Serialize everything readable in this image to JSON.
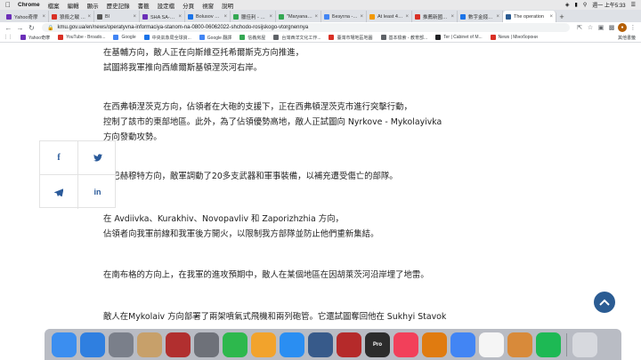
{
  "menubar": {
    "app": "Chrome",
    "items": [
      "檔案",
      "編輯",
      "顯示",
      "歷史記錄",
      "書籤",
      "設定檔",
      "分頁",
      "視窗",
      "說明"
    ],
    "clock": "週一 上午5:33",
    "apple_icon": "apple-icon"
  },
  "tabs": [
    {
      "label": "Yahoo奇摩",
      "color": "#6b2fb8"
    },
    {
      "label": "狼殺之戰 2：世",
      "color": "#d93025"
    },
    {
      "label": "Bl",
      "color": "#555555"
    },
    {
      "label": "SHA SA-伊莎卡",
      "color": "#6b2fb8"
    },
    {
      "label": "Bolusov Plus",
      "color": "#1a73e8"
    },
    {
      "label": "臘佳利 - Google",
      "color": "#34a853"
    },
    {
      "label": "\"Maryana Bezuh",
      "color": "#34a853"
    },
    {
      "label": "Безуглa - Goog",
      "color": "#4285f4"
    },
    {
      "label": "At least 4 expl",
      "color": "#f29900"
    },
    {
      "label": "推薦新國民報告",
      "color": "#d93025"
    },
    {
      "label": "數字金錢界 202",
      "color": "#1a73e8"
    },
    {
      "label": "The operation",
      "color": "#2b5c93",
      "active": true
    }
  ],
  "address": {
    "url": "kmu.gov.ua/en/news/operatyvna-informaciya-stanom-na-0800-06062022-shchodo-rosijskogo-vtorgnennya"
  },
  "bookmarks": [
    {
      "label": "Yahoo奇摩",
      "color": "#6b2fb8"
    },
    {
      "label": "YouTube - Broado...",
      "color": "#d93025"
    },
    {
      "label": "Google",
      "color": "#4285f4"
    },
    {
      "label": "中央氣象局全球資...",
      "color": "#1a73e8"
    },
    {
      "label": "Google 翻譯",
      "color": "#4285f4"
    },
    {
      "label": "信義房屋",
      "color": "#34a853"
    },
    {
      "label": "台灣西洋文化工作...",
      "color": "#5f6368"
    },
    {
      "label": "臺灣市場地區地圖",
      "color": "#d93025"
    },
    {
      "label": "基本檢索 - 教育部...",
      "color": "#5f6368"
    },
    {
      "label": "Ter | Cabinet of M...",
      "color": "#202124"
    },
    {
      "label": "News | Міноборони",
      "color": "#d93025"
    }
  ],
  "bookmarks_other": "其他書籤",
  "article": {
    "p1": "在基輔方向，敵人正在向斯維亞托希爾斯克方向推進，\n試圖將我軍推向西維爾斯基頓涅茨河右岸。",
    "p2": "在西弗頓涅茨克方向，佔領者在大砲的支援下，正在西弗頓涅茨克市進行突擊行動，\n控制了該市的東部地區。此外，為了佔領優勢高地，敵人正試圖向 Nyrkove - Mykolayivka\n方向發動攻勢。",
    "p3": "在巴赫穆特方向，敵軍調動了20多支武器和軍事裝備，以補充遭受傷亡的部隊。",
    "p4": "在 Avdiivka、Kurakhiv、Novopavliv 和 Zaporizhzhia 方向，\n佔領者向我軍前線和我軍後方開火，以限制我方部隊並防止他們重新集結。",
    "p5": "在南布格的方向上，在我軍的進攻預期中，敵人在某個地區在因胡萊茨河沿岸埋了地雷。",
    "p6": "敵人在Mykolaiv 方向部署了兩架噴氣式飛機和兩列砲管。它還試圖奪回他在 Sukhyi Stavok"
  },
  "share": {
    "facebook": "f",
    "linkedin": "in"
  },
  "dock": [
    {
      "name": "finder-icon",
      "color": "#3b8ef0"
    },
    {
      "name": "safari-icon",
      "color": "#2f7fe0"
    },
    {
      "name": "launchpad-icon",
      "color": "#7a7f8a"
    },
    {
      "name": "preview-icon",
      "color": "#c7a06a"
    },
    {
      "name": "photo-booth-icon",
      "color": "#b12f2f"
    },
    {
      "name": "system-preferences-icon",
      "color": "#6e7179"
    },
    {
      "name": "facetime-icon",
      "color": "#2db84d"
    },
    {
      "name": "pages-icon",
      "color": "#f2a32c"
    },
    {
      "name": "app-store-icon",
      "color": "#2a8ef2"
    },
    {
      "name": "google-earth-icon",
      "color": "#375a8a"
    },
    {
      "name": "photo-booth-red-icon",
      "color": "#b52a2a"
    },
    {
      "name": "final-cut-pro-icon",
      "color": "#2c2c2c"
    },
    {
      "name": "music-icon",
      "color": "#f2405a"
    },
    {
      "name": "vlc-icon",
      "color": "#e07b10"
    },
    {
      "name": "chrome-icon",
      "color": "#4285f4"
    },
    {
      "name": "photos-icon",
      "color": "#f5f5f5"
    },
    {
      "name": "paintbrush-icon",
      "color": "#d88a3a"
    },
    {
      "name": "spotify-icon",
      "color": "#1db954"
    },
    {
      "name": "trash-icon",
      "color": "#d7d9de"
    }
  ],
  "dock_labels": {
    "final_cut": "Pro"
  }
}
